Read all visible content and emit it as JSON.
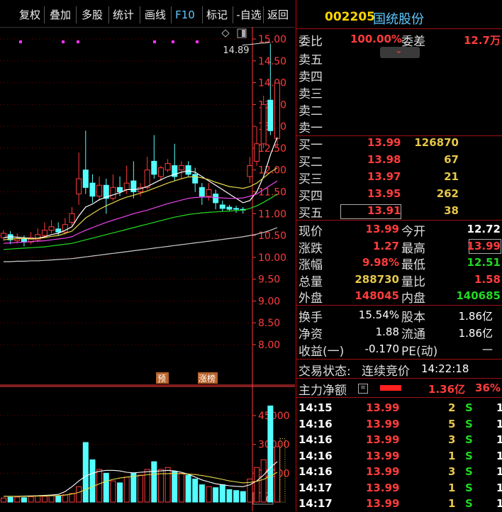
{
  "toolbar": {
    "items": [
      "复权",
      "叠加",
      "多股",
      "统计",
      "画线",
      "F10",
      "标记",
      "-自选",
      "返回"
    ],
    "selected": "F10"
  },
  "stock": {
    "code": "002205",
    "name": "国统股份"
  },
  "order_ratio": {
    "label": "委比",
    "value": "100.00%",
    "diff_label": "委差",
    "diff_value": "12.7万"
  },
  "sell_levels": [
    "卖五",
    "卖四",
    "卖三",
    "卖二",
    "卖一"
  ],
  "buy_levels": [
    {
      "label": "买一",
      "price": "13.99",
      "volume": "126870"
    },
    {
      "label": "买二",
      "price": "13.98",
      "volume": "67"
    },
    {
      "label": "买三",
      "price": "13.97",
      "volume": "21"
    },
    {
      "label": "买四",
      "price": "13.95",
      "volume": "262"
    },
    {
      "label": "买五",
      "price": "13.91",
      "volume": "38"
    }
  ],
  "quote": [
    {
      "l1": "现价",
      "v1": "13.99",
      "c1": "red",
      "l2": "今开",
      "v2": "12.72",
      "c2": "wht"
    },
    {
      "l1": "涨跌",
      "v1": "1.27",
      "c1": "red",
      "l2": "最高",
      "v2": "13.99",
      "c2": "red"
    },
    {
      "l1": "涨幅",
      "v1": "9.98%",
      "c1": "red",
      "l2": "最低",
      "v2": "12.51",
      "c2": "grn"
    },
    {
      "l1": "总量",
      "v1": "288730",
      "c1": "yel",
      "l2": "量比",
      "v2": "1.58",
      "c2": "red"
    },
    {
      "l1": "外盘",
      "v1": "148045",
      "c1": "red",
      "l2": "内盘",
      "v2": "140685",
      "c2": "grn"
    }
  ],
  "fund": [
    {
      "l1": "换手",
      "v1": "15.54%",
      "l2": "股本",
      "v2": "1.86亿"
    },
    {
      "l1": "净资",
      "v1": "1.88",
      "l2": "流通",
      "v2": "1.86亿"
    },
    {
      "l1": "收益(一)",
      "v1": "-0.170",
      "l2": "PE(动)",
      "v2": "—"
    }
  ],
  "trade_state": {
    "label": "交易状态:",
    "value": "连续竞价",
    "time": "14:22:18"
  },
  "main_flow": {
    "label": "主力净额",
    "value": "1.36亿",
    "pct": "36%"
  },
  "ticks": [
    {
      "time": "14:15",
      "price": "13.99",
      "vol": "2",
      "side": "S",
      "n": "1"
    },
    {
      "time": "14:16",
      "price": "13.99",
      "vol": "5",
      "side": "S",
      "n": "1"
    },
    {
      "time": "14:16",
      "price": "13.99",
      "vol": "3",
      "side": "S",
      "n": "1"
    },
    {
      "time": "14:16",
      "price": "13.99",
      "vol": "1",
      "side": "S",
      "n": "1"
    },
    {
      "time": "14:16",
      "price": "13.99",
      "vol": "3",
      "side": "S",
      "n": "1"
    },
    {
      "time": "14:17",
      "price": "13.99",
      "vol": "1",
      "side": "S",
      "n": "1"
    },
    {
      "time": "14:17",
      "price": "13.99",
      "vol": "1",
      "side": "S",
      "n": "1"
    }
  ],
  "chart_data": {
    "type": "candlestick",
    "price_axis": [
      "15.00",
      "14.50",
      "14.00",
      "13.50",
      "13.00",
      "12.50",
      "12.00",
      "11.50",
      "11.00",
      "10.50",
      "10.00",
      "9.50",
      "9.00",
      "8.50",
      "8.00"
    ],
    "price_ylim": [
      7.6,
      15.35
    ],
    "annotation_high": "14.89",
    "volume_axis": [
      "45000",
      "30000",
      "15000"
    ],
    "volume_ylim": [
      0,
      55000
    ],
    "volume_unit": "X10",
    "markers": [
      "预",
      "涨榜"
    ],
    "candles": [
      [
        10.45,
        10.55,
        10.62,
        10.38
      ],
      [
        10.52,
        10.4,
        10.6,
        10.3
      ],
      [
        10.38,
        10.42,
        10.55,
        10.32
      ],
      [
        10.42,
        10.35,
        10.5,
        10.25
      ],
      [
        10.35,
        10.45,
        10.58,
        10.3
      ],
      [
        10.4,
        10.52,
        10.66,
        10.35
      ],
      [
        10.5,
        10.62,
        10.8,
        10.45
      ],
      [
        10.62,
        10.7,
        10.85,
        10.55
      ],
      [
        10.65,
        10.58,
        10.8,
        10.5
      ],
      [
        10.58,
        10.75,
        10.9,
        10.52
      ],
      [
        10.8,
        11.0,
        11.15,
        10.7
      ],
      [
        11.45,
        11.8,
        12.4,
        11.2
      ],
      [
        12.0,
        11.6,
        12.9,
        11.45
      ],
      [
        11.7,
        11.4,
        11.9,
        11.25
      ],
      [
        11.4,
        11.65,
        11.85,
        11.3
      ],
      [
        11.65,
        11.35,
        11.8,
        11.0
      ],
      [
        11.35,
        11.6,
        11.9,
        11.3
      ],
      [
        11.6,
        11.5,
        11.85,
        11.4
      ],
      [
        11.55,
        11.7,
        12.1,
        11.45
      ],
      [
        11.75,
        11.5,
        12.2,
        11.35
      ],
      [
        11.5,
        11.6,
        11.7,
        11.4
      ],
      [
        11.6,
        12.0,
        12.3,
        11.55
      ],
      [
        12.2,
        11.9,
        12.8,
        11.8
      ],
      [
        11.85,
        12.05,
        12.1,
        11.75
      ],
      [
        12.0,
        12.15,
        12.25,
        11.95
      ],
      [
        12.1,
        11.85,
        12.6,
        11.75
      ],
      [
        12.0,
        12.1,
        12.2,
        11.8
      ],
      [
        12.1,
        11.9,
        12.2,
        11.85
      ],
      [
        11.9,
        11.7,
        12.05,
        11.5
      ],
      [
        11.6,
        11.4,
        11.7,
        11.2
      ],
      [
        11.4,
        11.55,
        11.7,
        11.3
      ],
      [
        11.45,
        11.25,
        11.55,
        11.1
      ],
      [
        11.2,
        11.12,
        11.3,
        11.05
      ],
      [
        11.15,
        11.1,
        11.2,
        11.05
      ],
      [
        11.12,
        11.1,
        11.18,
        11.02
      ],
      [
        11.1,
        11.08,
        11.15,
        11.0
      ],
      [
        11.85,
        12.1,
        12.3,
        11.7
      ],
      [
        12.2,
        12.6,
        13.0,
        12.1
      ],
      [
        12.6,
        13.5,
        13.7,
        12.5
      ],
      [
        13.6,
        12.9,
        14.89,
        12.8
      ],
      [
        12.72,
        13.99,
        13.99,
        12.51
      ]
    ],
    "volumes": [
      2100,
      2500,
      2600,
      2300,
      2800,
      3200,
      3000,
      3500,
      3300,
      3800,
      4500,
      8000,
      31000,
      22000,
      17000,
      15000,
      11000,
      10000,
      13000,
      15000,
      14000,
      17000,
      21000,
      17000,
      18000,
      16000,
      15000,
      14000,
      12000,
      9000,
      8000,
      7500,
      9000,
      6500,
      6000,
      5500,
      12000,
      18000,
      22000,
      50000,
      28800
    ],
    "volume_up": [
      true,
      false,
      true,
      false,
      true,
      true,
      true,
      true,
      false,
      true,
      true,
      true,
      false,
      false,
      true,
      false,
      true,
      false,
      true,
      false,
      true,
      true,
      false,
      true,
      true,
      false,
      true,
      false,
      false,
      false,
      true,
      false,
      false,
      false,
      false,
      false,
      true,
      true,
      true,
      false,
      true
    ],
    "volume_ma": [
      3000,
      3000,
      3000,
      3100,
      3200,
      3300,
      3500,
      3700,
      4000,
      5500,
      8000,
      11000,
      13500,
      15000,
      16000,
      16500,
      16500,
      16200,
      15500,
      15200,
      15500,
      15800,
      16000,
      16200,
      16500,
      16200,
      15500,
      14500,
      13000,
      11500,
      10500,
      9500,
      9000,
      8500,
      8200,
      8000,
      9000,
      11000,
      14000,
      18000,
      21000
    ],
    "volume_ma2": [
      3000,
      3000,
      3000,
      3000,
      3050,
      3100,
      3200,
      3300,
      3400,
      3600,
      4200,
      5000,
      6500,
      8000,
      9500,
      10800,
      11800,
      12500,
      13000,
      13400,
      13800,
      14200,
      14500,
      14700,
      14800,
      14900,
      14800,
      14600,
      14300,
      13800,
      13200,
      12500,
      11800,
      11000,
      10500,
      10000,
      10200,
      10800,
      11800,
      13500,
      15500
    ],
    "ma": [
      {
        "color": "#ffffff",
        "values": [
          10.45,
          10.47,
          10.46,
          10.45,
          10.43,
          10.44,
          10.47,
          10.52,
          10.55,
          10.62,
          10.7,
          10.95,
          11.15,
          11.22,
          11.32,
          11.38,
          11.43,
          11.48,
          11.55,
          11.55,
          11.57,
          11.62,
          11.7,
          11.78,
          11.85,
          11.9,
          11.95,
          11.98,
          11.95,
          11.85,
          11.75,
          11.65,
          11.55,
          11.45,
          11.35,
          11.25,
          11.3,
          11.5,
          11.85,
          12.35,
          12.75
        ]
      },
      {
        "color": "#e6d84a",
        "values": [
          10.4,
          10.42,
          10.43,
          10.43,
          10.42,
          10.43,
          10.45,
          10.48,
          10.5,
          10.55,
          10.6,
          10.75,
          10.9,
          11.0,
          11.1,
          11.18,
          11.25,
          11.32,
          11.38,
          11.42,
          11.47,
          11.52,
          11.58,
          11.64,
          11.7,
          11.75,
          11.8,
          11.84,
          11.85,
          11.82,
          11.78,
          11.72,
          11.67,
          11.62,
          11.6,
          11.58,
          11.62,
          11.7,
          11.82,
          11.95,
          12.05
        ]
      },
      {
        "color": "#ee44ee",
        "values": [
          10.32,
          10.33,
          10.34,
          10.35,
          10.36,
          10.37,
          10.38,
          10.4,
          10.42,
          10.44,
          10.47,
          10.55,
          10.62,
          10.68,
          10.74,
          10.8,
          10.85,
          10.9,
          10.95,
          11.0,
          11.04,
          11.08,
          11.13,
          11.18,
          11.23,
          11.27,
          11.31,
          11.35,
          11.37,
          11.38,
          11.38,
          11.37,
          11.36,
          11.35,
          11.35,
          11.36,
          11.4,
          11.45,
          11.55,
          11.65,
          11.75
        ]
      },
      {
        "color": "#22dd22",
        "values": [
          10.18,
          10.19,
          10.2,
          10.21,
          10.22,
          10.23,
          10.24,
          10.26,
          10.28,
          10.3,
          10.32,
          10.36,
          10.4,
          10.44,
          10.48,
          10.52,
          10.56,
          10.6,
          10.64,
          10.68,
          10.72,
          10.76,
          10.8,
          10.84,
          10.88,
          10.92,
          10.95,
          10.98,
          11.0,
          11.02,
          11.03,
          11.04,
          11.05,
          11.06,
          11.07,
          11.08,
          11.12,
          11.18,
          11.26,
          11.35,
          11.45
        ]
      },
      {
        "color": "#cccccc",
        "values": [
          9.9,
          9.9,
          9.91,
          9.91,
          9.92,
          9.92,
          9.93,
          9.94,
          9.95,
          9.96,
          9.97,
          9.99,
          10.01,
          10.03,
          10.05,
          10.07,
          10.09,
          10.11,
          10.13,
          10.15,
          10.17,
          10.19,
          10.21,
          10.23,
          10.25,
          10.27,
          10.29,
          10.31,
          10.33,
          10.35,
          10.37,
          10.39,
          10.41,
          10.43,
          10.45,
          10.47,
          10.5,
          10.53,
          10.57,
          10.62,
          10.68
        ]
      }
    ],
    "top_markers_count": 6
  },
  "colors": {
    "up": "#ff3c3c",
    "down": "#54ffff",
    "grid": "#7a0000",
    "axis": "#ff3c3c"
  }
}
